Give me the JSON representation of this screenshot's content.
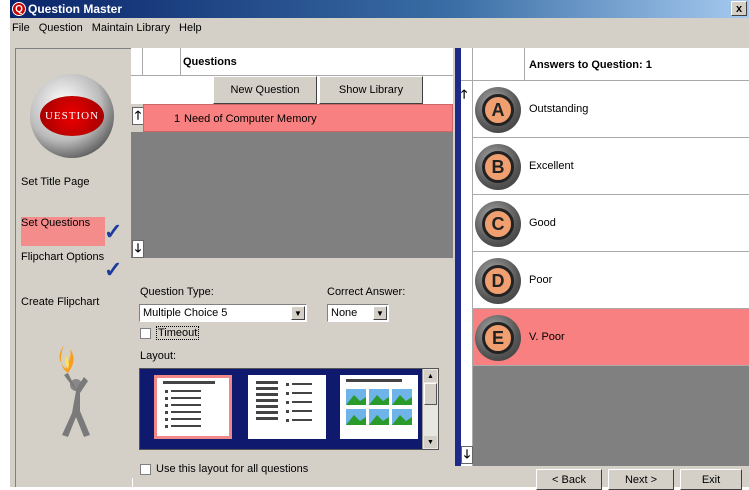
{
  "window": {
    "title": "Question Master",
    "close": "x"
  },
  "menu": [
    "File",
    "Question",
    "Maintain Library",
    "Help"
  ],
  "logo_text": "UESTION",
  "steps": {
    "title_page": "Set Title Page",
    "questions": "Set Questions",
    "flipchart_options": "Flipchart Options",
    "create": "Create Flipchart"
  },
  "questions": {
    "header": "Questions",
    "new_button": "New Question",
    "show_library_button": "Show Library",
    "rows": [
      {
        "num": "1",
        "text": "Need of Computer Memory"
      }
    ]
  },
  "options": {
    "type_label": "Question Type:",
    "type_value": "Multiple Choice 5",
    "correct_label": "Correct Answer:",
    "correct_value": "None",
    "timeout_label": "Timeout",
    "layout_label": "Layout:",
    "all_label": "Use this layout for all questions"
  },
  "answers": {
    "header": "Answers to Question: 1",
    "items": [
      {
        "letter": "A",
        "text": "Outstanding"
      },
      {
        "letter": "B",
        "text": "Excellent"
      },
      {
        "letter": "C",
        "text": "Good"
      },
      {
        "letter": "D",
        "text": "Poor"
      },
      {
        "letter": "E",
        "text": "V. Poor"
      }
    ]
  },
  "nav": {
    "back": "< Back",
    "next": "Next >",
    "exit": "Exit"
  },
  "colors": {
    "highlight": "#f88080",
    "accent": "#1d2a8a"
  }
}
